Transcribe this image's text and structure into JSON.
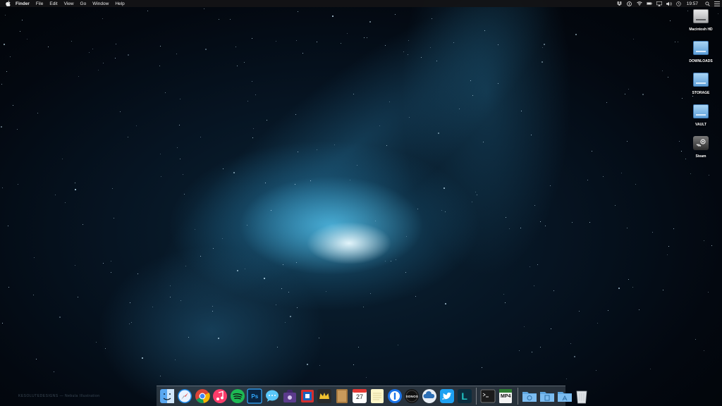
{
  "menubar": {
    "app_name": "Finder",
    "menus": [
      "File",
      "Edit",
      "View",
      "Go",
      "Window",
      "Help"
    ],
    "status_icons": [
      "dropbox-icon",
      "onepassword-icon",
      "wifi-icon",
      "battery-icon",
      "airplay-icon",
      "volume-icon",
      "time-machine-icon",
      "notifications-icon"
    ],
    "clock": "19:57"
  },
  "desktop": {
    "icons": [
      {
        "label": "Macintosh HD",
        "type": "internal-drive"
      },
      {
        "label": "DOWNLOADS",
        "type": "external-drive"
      },
      {
        "label": "STORAGE",
        "type": "external-drive"
      },
      {
        "label": "VAULT",
        "type": "external-drive"
      },
      {
        "label": "Steam",
        "type": "application"
      }
    ]
  },
  "watermark": "KESOLUTEDESIGNS — Nebula Illustration",
  "dock": {
    "apps": [
      {
        "name": "finder",
        "running": true
      },
      {
        "name": "safari",
        "running": false
      },
      {
        "name": "chrome",
        "running": true
      },
      {
        "name": "itunes",
        "running": false
      },
      {
        "name": "spotify",
        "running": true
      },
      {
        "name": "photoshop",
        "running": false,
        "label": "Ps"
      },
      {
        "name": "messages",
        "running": false
      },
      {
        "name": "alfred",
        "running": false
      },
      {
        "name": "parallels",
        "running": false
      },
      {
        "name": "crown-app",
        "running": false
      },
      {
        "name": "notefile",
        "running": false
      },
      {
        "name": "calendar",
        "running": false,
        "label": "27"
      },
      {
        "name": "notes",
        "running": false
      },
      {
        "name": "onepassword",
        "running": false
      },
      {
        "name": "sonos",
        "running": false,
        "label": "SONOS"
      },
      {
        "name": "screenshot-app",
        "running": false
      },
      {
        "name": "twitter",
        "running": false
      },
      {
        "name": "l-app",
        "running": false,
        "label": "L"
      },
      {
        "name": "terminal",
        "running": false
      },
      {
        "name": "mp4-tools",
        "running": false,
        "label": "MP4"
      }
    ],
    "folders": [
      "downloads-folder",
      "documents-folder",
      "applications-folder",
      "trash"
    ]
  },
  "colors": {
    "menubar_bg": "#141416",
    "dock_bg": "#46505a",
    "nebula_core": "#eafaff",
    "nebula_glow": "#2f8fc0"
  }
}
